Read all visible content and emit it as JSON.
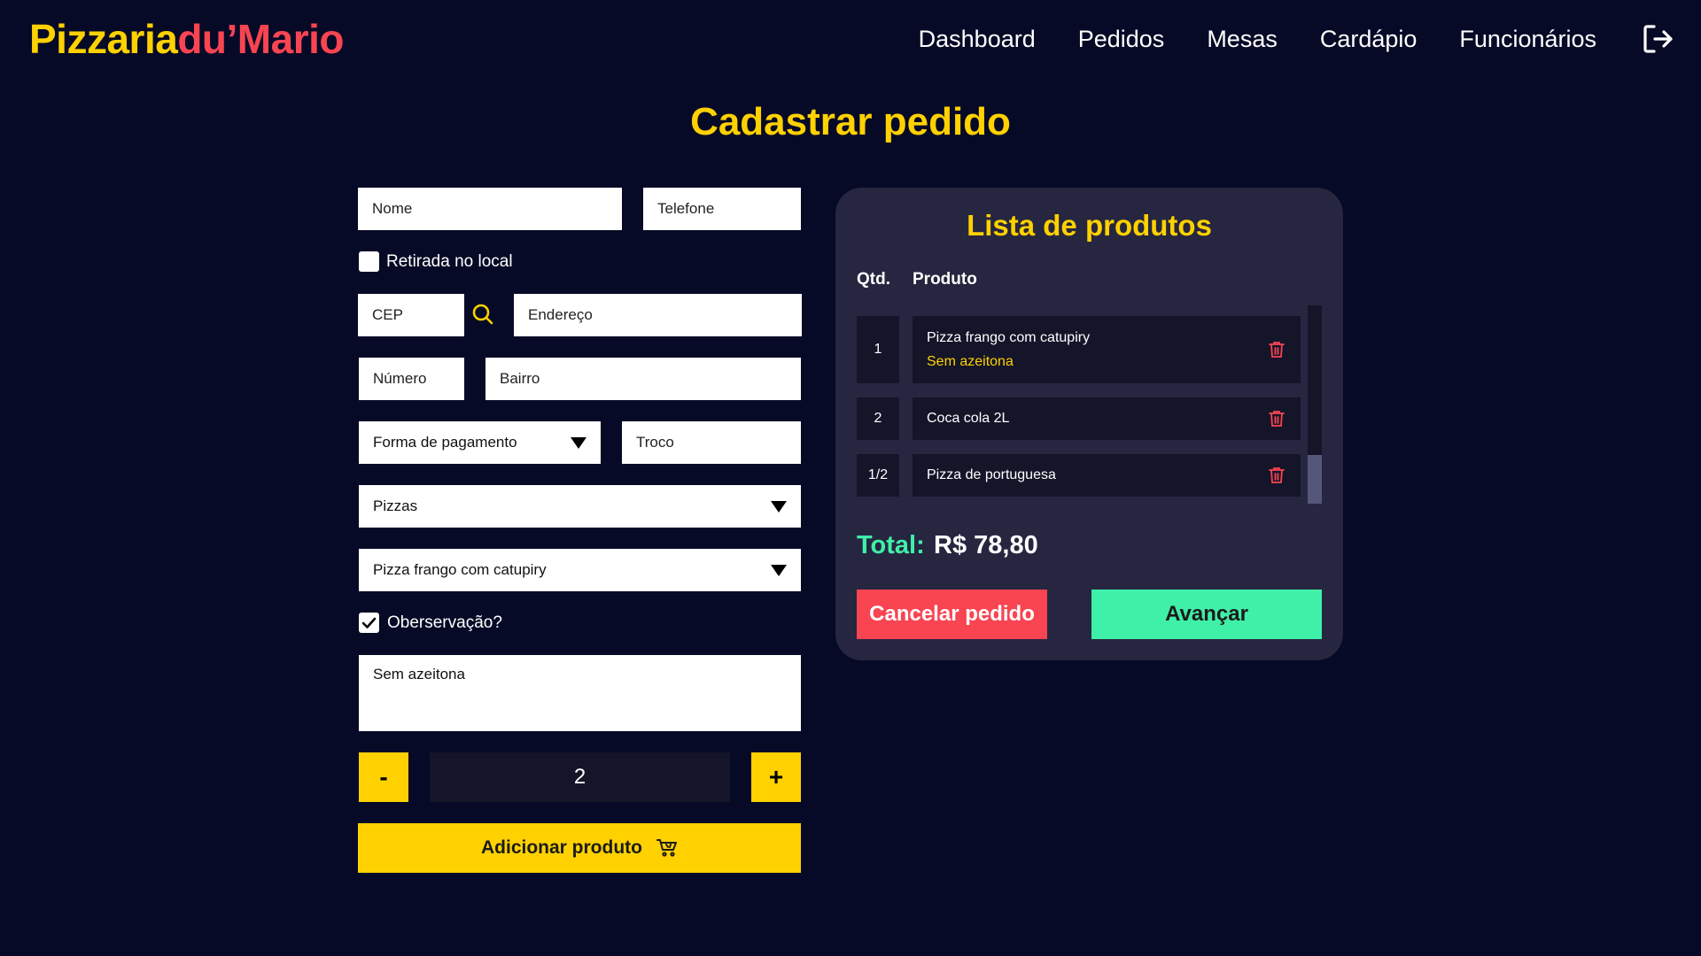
{
  "brand": {
    "part1": "Pizzaria",
    "part2": "du’Mario"
  },
  "nav": {
    "items": [
      "Dashboard",
      "Pedidos",
      "Mesas",
      "Cardápio",
      "Funcionários"
    ],
    "logout_icon": "logout-icon"
  },
  "page_title": "Cadastrar pedido",
  "form": {
    "nome_placeholder": "Nome",
    "telefone_placeholder": "Telefone",
    "retirada_label": "Retirada no local",
    "retirada_checked": false,
    "cep_placeholder": "CEP",
    "search_icon": "search-icon",
    "endereco_placeholder": "Endereço",
    "numero_placeholder": "Número",
    "bairro_placeholder": "Bairro",
    "pagamento_select": "Forma de pagamento",
    "troco_placeholder": "Troco",
    "categoria_select": "Pizzas",
    "produto_select": "Pizza frango com catupiry",
    "observacao_label": "Oberservação?",
    "observacao_checked": true,
    "observacao_text": "Sem azeitona",
    "minus_label": "-",
    "quantity": "2",
    "plus_label": "+",
    "add_button_label": "Adicionar produto",
    "cart_icon": "cart-icon"
  },
  "panel": {
    "title": "Lista de produtos",
    "col_qty": "Qtd.",
    "col_product": "Produto",
    "items": [
      {
        "qty": "1",
        "name": "Pizza frango com catupiry",
        "obs": "Sem azeitona"
      },
      {
        "qty": "2",
        "name": "Coca cola 2L",
        "obs": ""
      },
      {
        "qty": "1/2",
        "name": "Pizza de portuguesa",
        "obs": ""
      }
    ],
    "total_label": "Total:",
    "total_value": "R$ 78,80",
    "cancel_label": "Cancelar pedido",
    "next_label": "Avançar"
  },
  "colors": {
    "background": "#070a26",
    "accent_yellow": "#ffd100",
    "accent_red": "#f94452",
    "accent_green": "#3ff0a8",
    "panel": "#262640"
  }
}
